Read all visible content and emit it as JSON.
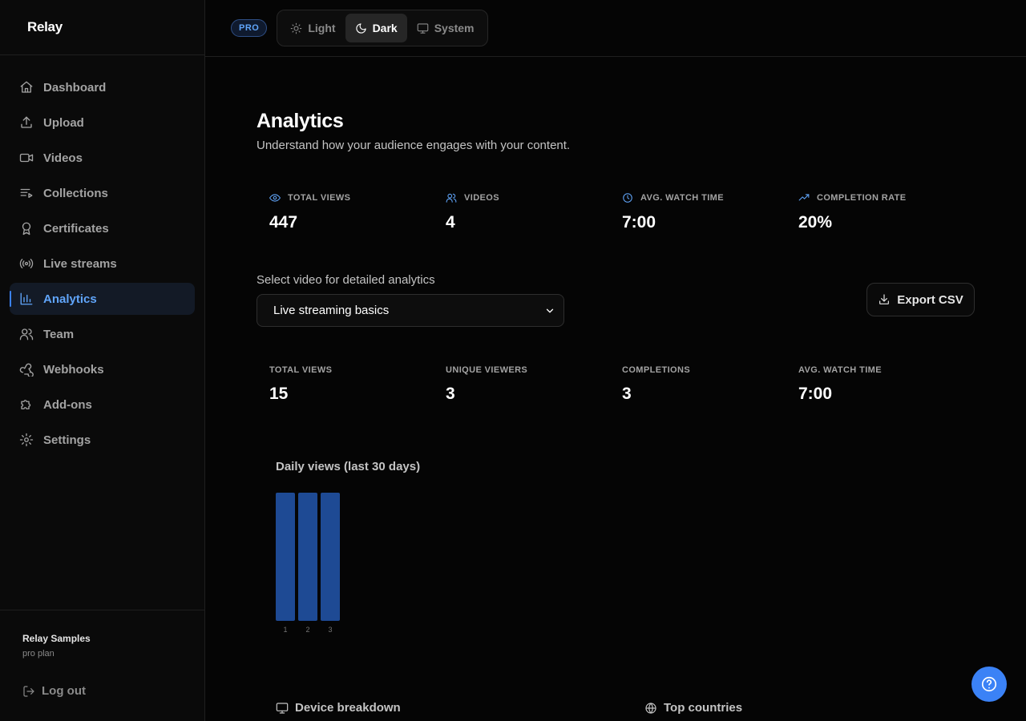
{
  "brand": {
    "name": "Relay"
  },
  "sidebar": {
    "items": [
      {
        "label": "Dashboard",
        "icon": "home-icon",
        "active": false
      },
      {
        "label": "Upload",
        "icon": "upload-icon",
        "active": false
      },
      {
        "label": "Videos",
        "icon": "video-icon",
        "active": false
      },
      {
        "label": "Collections",
        "icon": "list-play-icon",
        "active": false
      },
      {
        "label": "Certificates",
        "icon": "award-icon",
        "active": false
      },
      {
        "label": "Live streams",
        "icon": "broadcast-icon",
        "active": false
      },
      {
        "label": "Analytics",
        "icon": "bar-chart-icon",
        "active": true
      },
      {
        "label": "Team",
        "icon": "users-icon",
        "active": false
      },
      {
        "label": "Webhooks",
        "icon": "webhook-icon",
        "active": false
      },
      {
        "label": "Add-ons",
        "icon": "puzzle-icon",
        "active": false
      },
      {
        "label": "Settings",
        "icon": "gear-icon",
        "active": false
      }
    ],
    "account": {
      "name": "Relay Samples",
      "plan": "pro plan"
    },
    "logout_label": "Log out"
  },
  "topbar": {
    "plan_badge": "PRO",
    "theme": {
      "light": "Light",
      "dark": "Dark",
      "system": "System",
      "selected": "Dark"
    }
  },
  "page": {
    "title": "Analytics",
    "subtitle": "Understand how your audience engages with your content."
  },
  "overview_stats": [
    {
      "label": "TOTAL VIEWS",
      "value": "447",
      "icon": "eye-icon"
    },
    {
      "label": "VIDEOS",
      "value": "4",
      "icon": "users-icon"
    },
    {
      "label": "AVG. WATCH TIME",
      "value": "7:00",
      "icon": "clock-icon"
    },
    {
      "label": "COMPLETION RATE",
      "value": "20%",
      "icon": "trending-up-icon"
    }
  ],
  "video_select": {
    "label": "Select video for detailed analytics",
    "selected": "Live streaming basics"
  },
  "export_label": "Export CSV",
  "video_stats": [
    {
      "label": "TOTAL VIEWS",
      "value": "15"
    },
    {
      "label": "UNIQUE VIEWERS",
      "value": "3"
    },
    {
      "label": "COMPLETIONS",
      "value": "3"
    },
    {
      "label": "AVG. WATCH TIME",
      "value": "7:00"
    }
  ],
  "chart_data": {
    "type": "bar",
    "title": "Daily views (last 30 days)",
    "categories": [
      "1",
      "2",
      "3"
    ],
    "values": [
      5,
      5,
      5
    ],
    "color": "#1e4a94"
  },
  "sections": {
    "devices": "Device breakdown",
    "countries": "Top countries"
  },
  "colors": {
    "accent": "#3b82f6",
    "accent_text": "#60a5fa",
    "background": "#050505"
  }
}
